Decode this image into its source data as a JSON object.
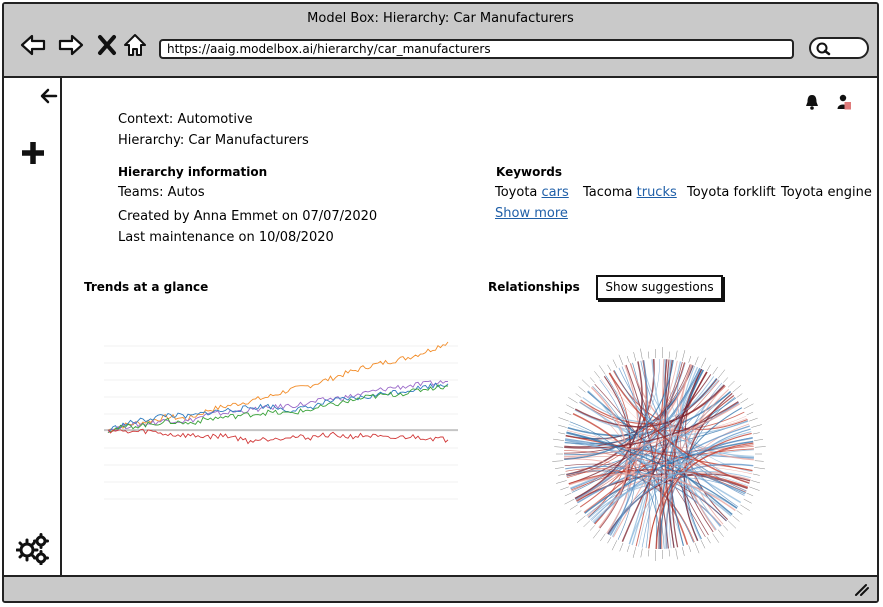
{
  "window": {
    "title": "Model Box: Hierarchy: Car Manufacturers"
  },
  "browser": {
    "url": "https://aaig.modelbox.ai/hierarchy/car_manufacturers"
  },
  "context": {
    "context_line": "Context: Automotive",
    "hierarchy_line": "Hierarchy: Car Manufacturers"
  },
  "hierarchy_info": {
    "heading": "Hierarchy information",
    "teams": "Teams: Autos",
    "created": "Created by Anna Emmet on 07/07/2020",
    "maintenance": "Last maintenance on 10/08/2020"
  },
  "keywords": {
    "heading": "Keywords",
    "items": [
      {
        "text": "Toyota ",
        "link": "cars"
      },
      {
        "text": "Tacoma ",
        "link": "trucks"
      },
      {
        "text": "Toyota forklift",
        "link": ""
      },
      {
        "text": "Toyota engine",
        "link": ""
      }
    ],
    "show_more": "Show more"
  },
  "trends": {
    "heading": "Trends at a glance"
  },
  "relationships": {
    "heading": "Relationships",
    "button": "Show suggestions"
  },
  "icons": {
    "back": "arrow-left-icon",
    "forward": "arrow-right-icon",
    "stop": "close-icon",
    "home": "home-icon",
    "search": "search-icon",
    "collapse": "arrow-left-icon",
    "add": "plus-icon",
    "settings": "gears-icon",
    "notifications": "bell-icon",
    "user": "user-icon",
    "resize": "resize-grip-icon"
  },
  "colors": {
    "chrome": "#c9c9c9",
    "link": "#1f5fa8"
  },
  "chart_data": {
    "type": "line",
    "title": "",
    "series": [
      {
        "color": "#f28c28",
        "values": [
          0,
          5,
          8,
          12,
          10,
          18,
          22,
          26,
          30,
          36,
          40,
          46,
          52,
          58,
          62,
          66,
          72,
          80
        ]
      },
      {
        "color": "#9b6ac9",
        "values": [
          0,
          4,
          6,
          9,
          8,
          14,
          16,
          18,
          20,
          22,
          24,
          28,
          30,
          34,
          38,
          40,
          42,
          44
        ]
      },
      {
        "color": "#2f7bbf",
        "values": [
          0,
          6,
          10,
          14,
          12,
          16,
          18,
          20,
          22,
          18,
          20,
          26,
          28,
          30,
          34,
          36,
          40,
          42
        ]
      },
      {
        "color": "#3aa23a",
        "values": [
          0,
          3,
          5,
          8,
          6,
          10,
          12,
          14,
          16,
          15,
          18,
          22,
          26,
          30,
          32,
          34,
          38,
          40
        ]
      },
      {
        "color": "#d13838",
        "values": [
          0,
          -2,
          -1,
          -4,
          -5,
          -6,
          -5,
          -10,
          -8,
          -6,
          -7,
          -4,
          -6,
          -5,
          -8,
          -6,
          -7,
          -9
        ]
      }
    ]
  }
}
